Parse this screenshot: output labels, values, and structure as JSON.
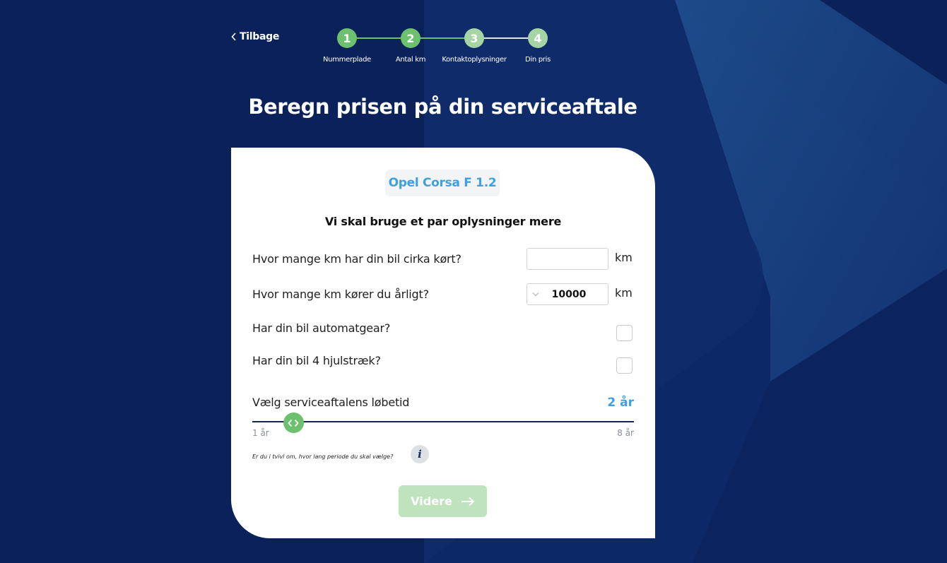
{
  "nav": {
    "back_label": "Tilbage"
  },
  "stepper": {
    "steps": [
      {
        "number": "1",
        "label": "Nummerplade",
        "state": "completed"
      },
      {
        "number": "2",
        "label": "Antal km",
        "state": "current"
      },
      {
        "number": "3",
        "label": "Kontaktoplysninger",
        "state": "upcoming"
      },
      {
        "number": "4",
        "label": "Din pris",
        "state": "upcoming"
      }
    ]
  },
  "page": {
    "title": "Beregn prisen på din serviceaftale"
  },
  "card": {
    "car_model": "Opel Corsa F 1.2",
    "subtitle": "Vi skal bruge et par oplysninger mere",
    "questions": {
      "total_km": {
        "label": "Hvor mange km har din bil cirka kørt?",
        "value": "",
        "placeholder": "",
        "unit": "km"
      },
      "yearly_km": {
        "label": "Hvor mange km kører du årligt?",
        "selected": "10000",
        "unit": "km"
      },
      "automatic": {
        "label": "Har din bil automatgear?",
        "checked": false
      },
      "awd": {
        "label": "Har din bil 4 hjulstræk?",
        "checked": false
      }
    },
    "duration": {
      "label": "Vælg serviceaftalens løbetid",
      "value_label": "2 år",
      "value": 2,
      "min": 1,
      "max": 8,
      "min_label": "1 år",
      "max_label": "8 år"
    },
    "hint": "Er du i tvivl om, hvor lang periode du skal vælge?",
    "info_icon": "i",
    "next_label": "Videre"
  },
  "colors": {
    "background": "#0a2159",
    "accent_blue": "#3f9fe0",
    "step_green": "#6cc06e",
    "step_green_light": "#a6d4a5",
    "button_disabled": "#bfe3bd"
  }
}
